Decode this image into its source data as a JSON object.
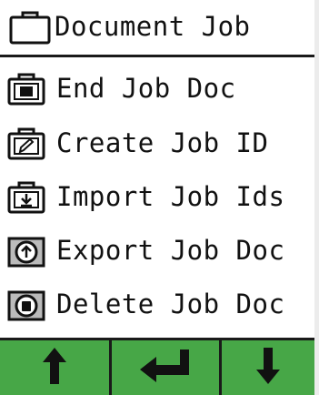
{
  "header": {
    "title": "Document Job",
    "icon": "briefcase-icon"
  },
  "menu": {
    "items": [
      {
        "label": "End Job Doc",
        "icon": "briefcase-stop-icon"
      },
      {
        "label": "Create Job ID",
        "icon": "briefcase-pencil-icon"
      },
      {
        "label": "Import Job Ids",
        "icon": "briefcase-import-icon"
      },
      {
        "label": "Export Job Doc",
        "icon": "briefcase-export-icon"
      },
      {
        "label": "Delete Job Doc",
        "icon": "briefcase-delete-icon"
      }
    ]
  },
  "softkeys": [
    {
      "icon": "arrow-up-icon"
    },
    {
      "icon": "enter-icon"
    },
    {
      "icon": "arrow-down-icon"
    }
  ],
  "colors": {
    "softkey_bar": "#47a747",
    "text": "#111111",
    "background": "#ffffff"
  }
}
